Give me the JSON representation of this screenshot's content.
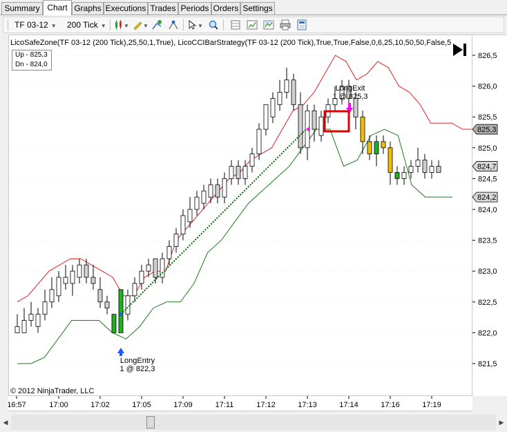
{
  "tabs": [
    "Summary",
    "Chart",
    "Graphs",
    "Executions",
    "Trades",
    "Periods",
    "Orders",
    "Settings"
  ],
  "active_tab": "Chart",
  "toolbar": {
    "instrument": "TF 03-12",
    "interval": "200 Tick"
  },
  "chart": {
    "indicator_label": "LicoSafeZone(TF 03-12 (200 Tick),25,50,1,True), LicoCCIBarStrategy(TF 03-12 (200 Tick),True,True,False,0,6,25,10,50,50,False,5",
    "legend_up": "Up - 825,3",
    "legend_dn": "Dn - 824,0",
    "copyright": "© 2012 NinjaTrader, LLC",
    "entry_label": "LongEntry",
    "entry_detail": "1 @ 822,3",
    "exit_label": "LongExit",
    "exit_detail": "1 @ 825,3"
  },
  "chart_data": {
    "type": "candlestick",
    "y_ticks": [
      "826,5",
      "826,0",
      "825,5",
      "825,0",
      "824,5",
      "824,0",
      "823,5",
      "823,0",
      "822,5",
      "822,0",
      "821,5"
    ],
    "x_ticks": [
      "16:57",
      "17:00",
      "17:02",
      "17:05",
      "17:09",
      "17:11",
      "17:12",
      "17:13",
      "17:14",
      "17:16",
      "17:19"
    ],
    "ylim": [
      821.3,
      826.7
    ],
    "price_markers": [
      {
        "label": "825,3",
        "color": "#b0b0b0"
      },
      {
        "label": "824,7",
        "color": "#d8d8d8"
      },
      {
        "label": "824,2",
        "color": "#d8d8d8"
      }
    ],
    "bars": [
      [
        822.0,
        822.1,
        822.3,
        822.0
      ],
      [
        822.0,
        822.2,
        822.4,
        822.0
      ],
      [
        822.2,
        822.3,
        822.5,
        822.1
      ],
      [
        822.1,
        822.3,
        822.4,
        822.0
      ],
      [
        822.3,
        822.5,
        822.7,
        822.2
      ],
      [
        822.5,
        822.7,
        822.9,
        822.4
      ],
      [
        822.6,
        822.9,
        823.0,
        822.5
      ],
      [
        822.8,
        822.9,
        823.1,
        822.7
      ],
      [
        822.8,
        823.0,
        823.1,
        822.6
      ],
      [
        822.9,
        823.1,
        823.2,
        822.8
      ],
      [
        823.1,
        822.9,
        823.2,
        822.8
      ],
      [
        822.9,
        822.8,
        823.1,
        822.7
      ],
      [
        822.7,
        822.5,
        822.9,
        822.4
      ],
      [
        822.5,
        822.4,
        822.6,
        822.3
      ],
      [
        822.0,
        822.3,
        822.3,
        822.0
      ],
      [
        822.0,
        822.7,
        822.7,
        822.0
      ],
      [
        822.3,
        822.6,
        822.7,
        822.2
      ],
      [
        822.6,
        822.8,
        822.9,
        822.5
      ],
      [
        822.8,
        823.0,
        823.1,
        822.7
      ],
      [
        823.0,
        823.1,
        823.2,
        822.9
      ],
      [
        823.2,
        822.9,
        823.2,
        822.8
      ],
      [
        822.9,
        823.2,
        823.3,
        822.8
      ],
      [
        823.2,
        823.4,
        823.5,
        823.1
      ],
      [
        823.4,
        823.6,
        823.7,
        823.3
      ],
      [
        823.6,
        823.9,
        824.0,
        823.5
      ],
      [
        823.8,
        824.0,
        824.2,
        823.7
      ],
      [
        824.0,
        824.2,
        824.3,
        823.9
      ],
      [
        824.1,
        824.3,
        824.4,
        824.0
      ],
      [
        824.2,
        824.4,
        824.5,
        824.1
      ],
      [
        824.4,
        824.2,
        824.5,
        824.1
      ],
      [
        824.2,
        824.5,
        824.6,
        824.1
      ],
      [
        824.5,
        824.7,
        824.8,
        824.4
      ],
      [
        824.7,
        824.5,
        824.8,
        824.4
      ],
      [
        824.5,
        824.7,
        824.8,
        824.4
      ],
      [
        824.7,
        824.9,
        825.0,
        824.6
      ],
      [
        824.9,
        825.3,
        825.4,
        824.8
      ],
      [
        825.3,
        825.7,
        825.7,
        825.2
      ],
      [
        825.5,
        825.8,
        825.9,
        825.4
      ],
      [
        825.7,
        825.9,
        826.1,
        825.6
      ],
      [
        825.9,
        826.1,
        826.3,
        825.8
      ],
      [
        826.1,
        825.7,
        826.2,
        825.6
      ],
      [
        825.7,
        825.0,
        825.9,
        824.9
      ],
      [
        825.0,
        825.6,
        825.7,
        824.8
      ],
      [
        825.6,
        825.3,
        825.7,
        825.1
      ],
      [
        825.2,
        825.5,
        825.6,
        825.1
      ],
      [
        825.5,
        825.7,
        825.8,
        825.4
      ],
      [
        825.7,
        825.8,
        826.0,
        825.6
      ],
      [
        825.8,
        826.0,
        826.1,
        825.7
      ],
      [
        826.0,
        825.8,
        826.1,
        825.7
      ],
      [
        825.8,
        825.5,
        825.9,
        825.3
      ],
      [
        825.5,
        825.1,
        825.6,
        824.9
      ],
      [
        825.1,
        824.9,
        825.2,
        824.8
      ],
      [
        824.9,
        825.1,
        825.2,
        824.7
      ],
      [
        825.1,
        825.0,
        825.2,
        824.9
      ],
      [
        825.0,
        824.6,
        825.1,
        824.4
      ],
      [
        824.6,
        824.5,
        824.7,
        824.4
      ],
      [
        824.5,
        824.6,
        824.7,
        824.4
      ],
      [
        824.6,
        824.7,
        824.8,
        824.5
      ],
      [
        824.7,
        824.8,
        825.0,
        824.6
      ],
      [
        824.8,
        824.6,
        824.9,
        824.5
      ],
      [
        824.6,
        824.7,
        824.8,
        824.5
      ],
      [
        824.7,
        824.6,
        824.8,
        824.6
      ]
    ],
    "bar_colors": [
      "o",
      "o",
      "o",
      "o",
      "o",
      "o",
      "o",
      "o",
      "o",
      "o",
      "o",
      "o",
      "o",
      "o",
      "G",
      "G",
      "o",
      "o",
      "o",
      "o",
      "o",
      "o",
      "o",
      "o",
      "o",
      "o",
      "o",
      "o",
      "o",
      "o",
      "o",
      "o",
      "o",
      "o",
      "o",
      "o",
      "o",
      "o",
      "o",
      "o",
      "o",
      "o",
      "o",
      "o",
      "o",
      "o",
      "o",
      "o",
      "o",
      "o",
      "Y",
      "Y",
      "G",
      "Y",
      "Y",
      "G",
      "o",
      "o",
      "o",
      "o",
      "o",
      "o"
    ],
    "upper_band": [
      822.5,
      822.6,
      822.8,
      823.0,
      823.1,
      823.2,
      823.2,
      823.1,
      823.0,
      822.9,
      822.6,
      822.6,
      822.9,
      823.0,
      823.0,
      823.5,
      823.7,
      823.9,
      824.1,
      824.3,
      824.5,
      824.6,
      824.8,
      824.9,
      825.0,
      825.3,
      825.6,
      825.7,
      825.9,
      826.2,
      826.5,
      826.4,
      826.1,
      826.2,
      826.4,
      826.3,
      826.0,
      825.9,
      825.7,
      825.4,
      825.4,
      825.4,
      825.3,
      825.3
    ],
    "lower_band": [
      821.5,
      821.5,
      821.6,
      821.9,
      822.2,
      822.2,
      822.2,
      822.0,
      821.9,
      822.1,
      822.4,
      822.5,
      822.5,
      822.8,
      823.3,
      823.5,
      823.8,
      824.1,
      824.3,
      824.5,
      824.7,
      825.0,
      825.3,
      825.3,
      824.7,
      824.8,
      825.2,
      825.3,
      825.2,
      824.4,
      824.2,
      824.2,
      824.2
    ],
    "entry_price": 822.3,
    "exit_price": 825.3
  }
}
